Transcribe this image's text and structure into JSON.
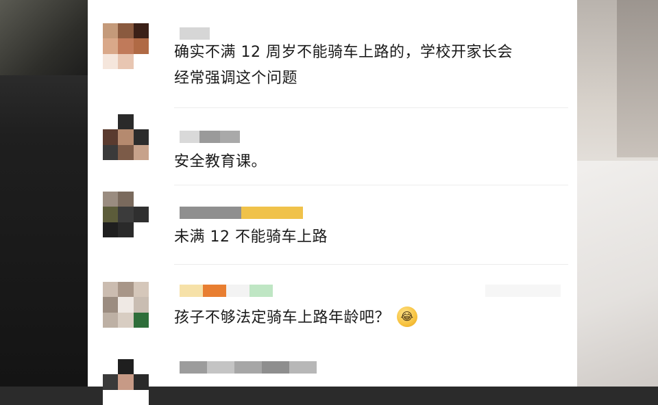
{
  "comments": [
    {
      "text_lines": [
        "确实不满 12 周岁不能骑车上路的，学校开家长会",
        "经常强调这个问题"
      ],
      "avatar_colors": [
        "#c49a7a",
        "#8a5a3f",
        "#3b2017",
        "#d9a889",
        "#c07a5a",
        "#b06a45",
        "#f5e6dc",
        "#e8c6b2",
        "#ffffff"
      ]
    },
    {
      "text_lines": [
        "安全教育课。"
      ],
      "avatar_colors": [
        "#ffffff",
        "#2a2a2a",
        "#ffffff",
        "#5a3b2f",
        "#b58a6f",
        "#2c2c2c",
        "#3a3a3a",
        "#7c5b48",
        "#c7a28b"
      ]
    },
    {
      "text_lines": [
        "未满 12 不能骑车上路"
      ],
      "avatar_colors": [
        "#9a8c80",
        "#7a6a5d",
        "#ffffff",
        "#5c5c3a",
        "#3b3b3b",
        "#2f2f2f",
        "#1f1f1f",
        "#2a2a2a",
        "#ffffff"
      ]
    },
    {
      "text_lines": [
        "孩子不够法定骑车上路年龄吧？"
      ],
      "emoji_icon": "laugh-cry-icon",
      "emoji_glyph": "😂",
      "avatar_colors": [
        "#cbbcb0",
        "#a89688",
        "#d5c7ba",
        "#9b8c80",
        "#efe9e4",
        "#c9bdb2",
        "#bdb0a4",
        "#d8cdc2",
        "#2e6e3a"
      ]
    },
    {
      "text_lines": [
        ""
      ],
      "avatar_colors": [
        "#ffffff",
        "#1f1f1f",
        "#ffffff",
        "#3a3a3a",
        "#c79a86",
        "#2a2a2a",
        "#ffffff",
        "#ffffff",
        "#ffffff"
      ]
    }
  ],
  "name_bar_colors": {
    "c1": [
      "#d6d6d6"
    ],
    "c2": [
      "#d9d9d9",
      "#9a9a9a",
      "#a9a9a9"
    ],
    "c3": [
      "#8f8f8f",
      "#f0c24a"
    ],
    "c4": [
      "#f6e1a8",
      "#e87e31",
      "#f3f3f3",
      "#bfe6c4"
    ],
    "c5": [
      "#9c9c9c",
      "#c4c4c4",
      "#a6a6a6",
      "#8e8e8e",
      "#b7b7b7"
    ]
  }
}
